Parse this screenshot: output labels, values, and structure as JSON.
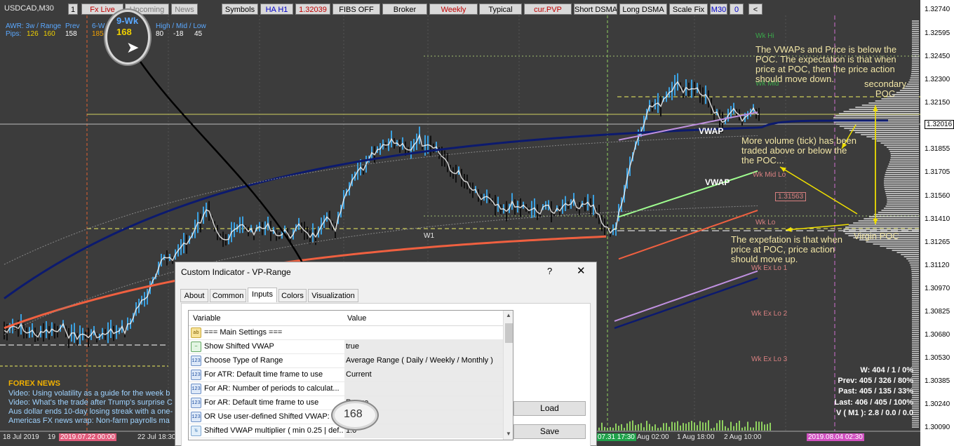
{
  "symbol": "USDCAD,M30",
  "toolbar": [
    {
      "label": "1",
      "cls": ""
    },
    {
      "label": "Fx Live",
      "cls": "red"
    },
    {
      "label": "Upcoming",
      "cls": "dim"
    },
    {
      "label": "News",
      "cls": "dim"
    },
    {
      "label": "Symbols",
      "cls": ""
    },
    {
      "label": "HA H1",
      "cls": "blue"
    },
    {
      "label": "1.32039",
      "cls": "red"
    },
    {
      "label": "FIBS OFF",
      "cls": ""
    },
    {
      "label": "Broker",
      "cls": ""
    },
    {
      "label": "Weekly",
      "cls": "red"
    },
    {
      "label": "Typical",
      "cls": ""
    },
    {
      "label": "cur.PVP",
      "cls": "red"
    },
    {
      "label": "Short DSMA",
      "cls": ""
    },
    {
      "label": "Long DSMA",
      "cls": ""
    },
    {
      "label": "Scale Fix",
      "cls": ""
    },
    {
      "label": "M30",
      "cls": "blue"
    },
    {
      "label": "0",
      "cls": "blue"
    },
    {
      "label": "<",
      "cls": ""
    }
  ],
  "awr": {
    "header": "AWR: 3w / Range",
    "prev_label": "Prev",
    "six_wk_label": "6-W",
    "hml_label": "High / Mid / Low",
    "pips_label": "Pips:",
    "v1": "126",
    "v2": "160",
    "prev": "158",
    "six": "185",
    "h": "80",
    "m": "-18",
    "l": "45"
  },
  "callout": {
    "label": "9-Wk",
    "value": "168"
  },
  "chart_data": {
    "type": "candlestick",
    "price_axis": [
      "1.32740",
      "1.32595",
      "1.32450",
      "1.32300",
      "1.32150",
      "1.32016",
      "1.31855",
      "1.31705",
      "1.31560",
      "1.31410",
      "1.31265",
      "1.31120",
      "1.30970",
      "1.30825",
      "1.30680",
      "1.30530",
      "1.30385",
      "1.30240",
      "1.30090"
    ],
    "current_price": "1.32016",
    "time_axis": [
      "18 Jul 2019",
      "19",
      "2019.07.22 00:00",
      "22 Jul 18:30",
      "07.31 17:30",
      "Aug 02:00",
      "1 Aug 18:00",
      "2 Aug 10:00",
      "2019.08.04 02:30"
    ],
    "levels": [
      "Wk Hi",
      "Wk Mid",
      "Wk Mid Lo",
      "Wk Lo",
      "Wk Ex Lo 1",
      "Wk Ex Lo 2",
      "Wk Ex Lo 3",
      "W1"
    ],
    "price_box": "1.31563",
    "vwap_labels": [
      "VWAP",
      "VWAP"
    ],
    "annotations": {
      "a1": [
        "The VWAPs  and Price is below the",
        "POC.  The expectation is that when",
        "price at POC, then the price action",
        "should move down."
      ],
      "a2": [
        "secondary",
        "POC"
      ],
      "a3": [
        "More volume (tick) has been",
        "traded above or below the",
        "the POC..."
      ],
      "a4": [
        "The expefation is that when",
        "price  at POC,  price action",
        "should move up."
      ],
      "a5": "Virgin POC"
    }
  },
  "news": {
    "title": "FOREX NEWS",
    "items": [
      "Video: Using volatility as a guide for the week b",
      "Video: What's the trade after Trump's surprise C",
      "Aus dollar ends 10-day losing streak with a one-",
      "Americas FX news wrap: Non-farm payrolls ma"
    ]
  },
  "stats": [
    "W: 404 / 1 / 0%",
    "Prev: 405 / 326 / 80%",
    "Past: 405 / 135 / 33%",
    "Last: 406 / 405 / 100%",
    "V ( M1 ): 2.8 / 0.0 / 0.0"
  ],
  "dialog": {
    "title": "Custom Indicator - VP-Range",
    "help": "?",
    "close": "✕",
    "tabs": [
      "About",
      "Common",
      "Inputs",
      "Colors",
      "Visualization"
    ],
    "active_tab": "Inputs",
    "col_variable": "Variable",
    "col_value": "Value",
    "rows": [
      {
        "icon": "ab",
        "name": "=== Main Settings ===",
        "value": ""
      },
      {
        "icon": "line",
        "name": "Show Shifted VWAP",
        "value": "true"
      },
      {
        "icon": "num",
        "name": "Choose Type of Range",
        "value": "Average Range ( Daily / Weekly / Monthly )"
      },
      {
        "icon": "num",
        "name": "For ATR: Default time frame to use",
        "value": "Current"
      },
      {
        "icon": "num",
        "name": "For   AR: Number of periods to calculat...",
        "value": ""
      },
      {
        "icon": "num",
        "name": "For   AR: Default time frame to use",
        "value": "Range"
      },
      {
        "icon": "num",
        "name": "OR Use user-defined Shifted VWAP: n",
        "value": ""
      },
      {
        "icon": "frac",
        "name": "Shifted VWAP multiplier ( min 0.25 | def...",
        "value": "1.0"
      }
    ],
    "load": "Load",
    "save": "Save",
    "magnify_value": "168"
  },
  "icon_text": {
    "ab": "ab",
    "num": "123",
    "line": "~",
    "frac": "½"
  }
}
